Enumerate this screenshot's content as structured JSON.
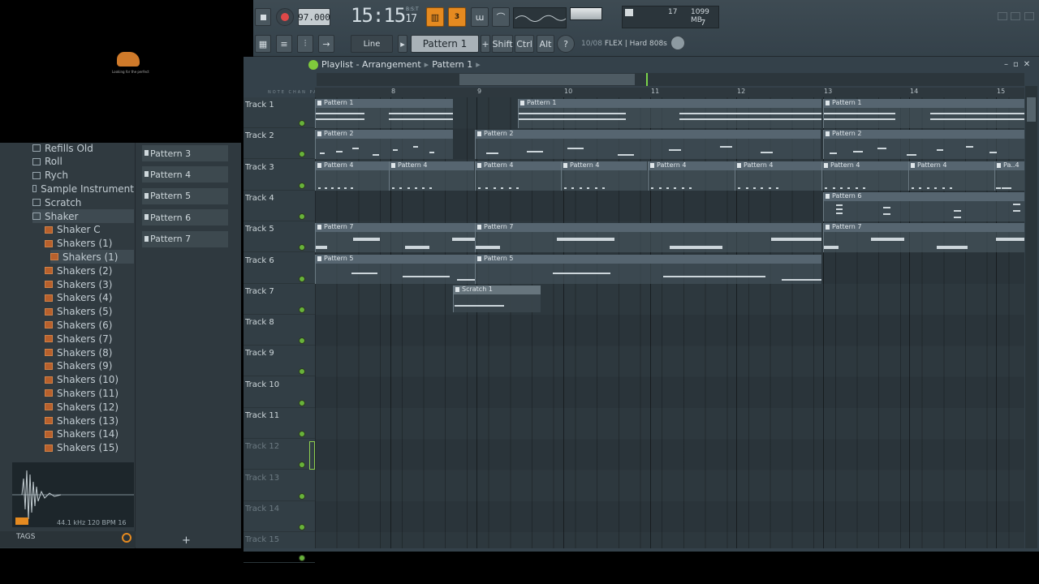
{
  "toolbar": {
    "tempo": "97.000",
    "clock_main": "15:15",
    "clock_small": "17",
    "clock_sup": "B:S:T",
    "blend_label": "3",
    "poly": "17",
    "memory": "1099 MB",
    "cpu": "7",
    "snap": "Line",
    "pattern": "Pattern 1",
    "shift": "Shift",
    "ctrl": "Ctrl",
    "alt": "Alt",
    "hint_index": "10/08",
    "hint_text": "FLEX | Hard 808s"
  },
  "playlist": {
    "title": "Playlist - Arrangement",
    "sub": "Pattern 1",
    "ruler_ticks": [
      "8",
      "9",
      "10",
      "11",
      "12",
      "13",
      "14",
      "15"
    ],
    "tool_labels": "NOTE CHAN PAT"
  },
  "tracks": [
    "Track 1",
    "Track 2",
    "Track 3",
    "Track 4",
    "Track 5",
    "Track 6",
    "Track 7",
    "Track 8",
    "Track 9",
    "Track 10",
    "Track 11",
    "Track 12",
    "Track 13",
    "Track 14",
    "Track 15"
  ],
  "clips": {
    "p1": "Pattern 1",
    "p2": "Pattern 2",
    "p4": "Pattern 4",
    "p4s": "Pa..4",
    "p5": "Pattern 5",
    "p6": "Pattern 6",
    "p7": "Pattern 7",
    "scratch": "Scratch 1"
  },
  "browser": {
    "items": [
      "Refills Old",
      "Roll",
      "Rych",
      "Sample Instrument",
      "Scratch",
      "Shaker",
      "Shaker C",
      "Shakers (1)",
      "Shakers (1)",
      "Shakers (2)",
      "Shakers (3)",
      "Shakers (4)",
      "Shakers (5)",
      "Shakers (6)",
      "Shakers (7)",
      "Shakers (8)",
      "Shakers (9)",
      "Shakers (10)",
      "Shakers (11)",
      "Shakers (12)",
      "Shakers (13)",
      "Shakers (14)",
      "Shakers (15)"
    ],
    "wave_info": "44.1 kHz 120 BPM 16",
    "tags": "TAGS"
  },
  "picker": [
    "Pattern 3",
    "Pattern 4",
    "Pattern 5",
    "Pattern 6",
    "Pattern 7"
  ],
  "logo_text": "Looking for the perfect",
  "colors": {
    "accent": "#e58a20",
    "led": "#68b23a",
    "background": "#34414a"
  }
}
